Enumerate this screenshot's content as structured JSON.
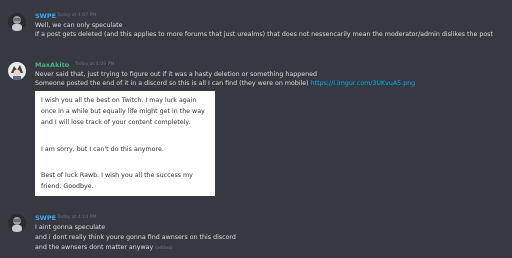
{
  "colors": {
    "background": "#36393f",
    "username_swpe": "#3aa8f2",
    "username_maxakito": "#43b581",
    "text": "#dcddde",
    "timestamp": "#6b6f75",
    "link": "#00b0f4"
  },
  "messages": [
    {
      "avatar_icon": "avatar-swpe",
      "username": "SWPE",
      "timestamp": "Today at 4:07 PM",
      "lines": [
        "Well, we can only speculate",
        "If a post gets deleted (and this applies to more forums that just urealms)  that does not nessencarily mean the moderator/admin dislikes the post"
      ]
    },
    {
      "avatar_icon": "avatar-maxakito",
      "username": "MaxAkito",
      "timestamp": "Today at 4:09 PM",
      "line1": "Never said that, just trying to figure out if it was a hasty deletion or something happened",
      "line2_text": "Someone posted the end of it in a discord so this is all I can find (they were on mobile) ",
      "line2_link": "https://i.imgur.com/3UKvuA5.png",
      "image_text": [
        "I wish you all the best on Twitch. I may lurk again",
        "once in a while but equally life might get in the way",
        "and I will lose track of your content completely.",
        "",
        "I am sorry, but I can't do this anymore.",
        "",
        "Best of luck Rawb. I wish you all the success my",
        "friend. Goodbye."
      ]
    },
    {
      "avatar_icon": "avatar-swpe",
      "username": "SWPE",
      "timestamp": "Today at 4:14 PM",
      "line1": "I aint gonna speculate",
      "line2": "and i dont really think youre gonna find awnsers on this discord",
      "line3_text": "and the awnsers dont matter anyway ",
      "line3_edited": "(edited)"
    }
  ]
}
